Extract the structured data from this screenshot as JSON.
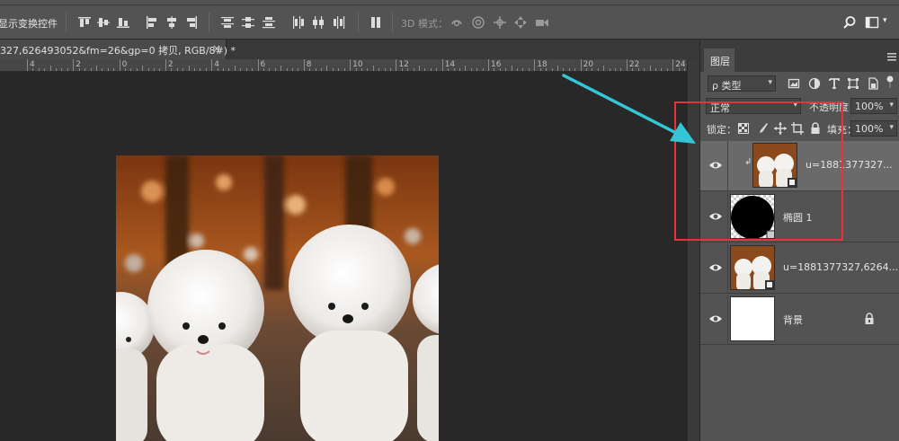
{
  "options_bar": {
    "transform_controls_label": "显示变换控件",
    "mode_3d_label": "3D 模式："
  },
  "document": {
    "tab_title": "327,626493052&fm=26&gp=0 拷贝, RGB/8#) *",
    "close_glyph": "×",
    "ruler_labels": [
      "4",
      "2",
      "0",
      "2",
      "4",
      "6",
      "8",
      "10",
      "12",
      "14",
      "16",
      "18",
      "20",
      "22",
      "24"
    ]
  },
  "layers_panel": {
    "tab_label": "图层",
    "filter_kind": "ρ 类型",
    "blend_mode": "正常",
    "opacity_label": "不透明度：",
    "opacity_value": "100%",
    "lock_label": "锁定：",
    "fill_label": "填充：",
    "fill_value": "100%",
    "layers": [
      {
        "name": "u=1881377327...",
        "selected": true,
        "clipped": true
      },
      {
        "name": "椭圆 1",
        "selected": false
      },
      {
        "name": "u=1881377327,6264...",
        "selected": false
      },
      {
        "name": "背景",
        "selected": false,
        "locked": true
      }
    ]
  },
  "colors": {
    "annotation_box": "#e8313c",
    "annotation_arrow": "#35c6d6",
    "panel_bg": "#535353",
    "selected_layer": "#6a6a6a"
  }
}
